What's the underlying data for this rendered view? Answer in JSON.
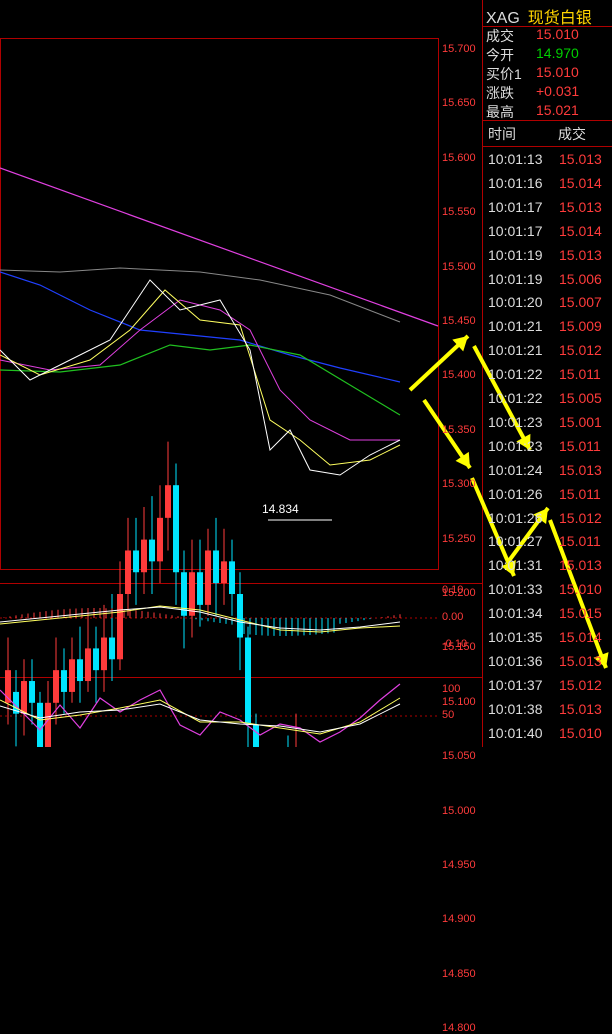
{
  "header": {
    "symbol": "XAG",
    "name": "现货白银"
  },
  "quote": [
    {
      "label": "成交",
      "value": "15.010",
      "color": "#ff3b3b"
    },
    {
      "label": "今开",
      "value": "14.970",
      "color": "#00d000"
    },
    {
      "label": "买价1",
      "value": "15.010",
      "color": "#ff3b3b"
    },
    {
      "label": "涨跌",
      "value": "+0.031",
      "color": "#ff3b3b"
    },
    {
      "label": "最高",
      "value": "15.021",
      "color": "#ff3b3b"
    }
  ],
  "tick_header": {
    "time": "时间",
    "price": "成交"
  },
  "ticks": [
    {
      "time": "10:01:13",
      "price": "15.013"
    },
    {
      "time": "10:01:16",
      "price": "15.014"
    },
    {
      "time": "10:01:17",
      "price": "15.013"
    },
    {
      "time": "10:01:17",
      "price": "15.014"
    },
    {
      "time": "10:01:19",
      "price": "15.013"
    },
    {
      "time": "10:01:19",
      "price": "15.006"
    },
    {
      "time": "10:01:20",
      "price": "15.007"
    },
    {
      "time": "10:01:21",
      "price": "15.009"
    },
    {
      "time": "10:01:21",
      "price": "15.012"
    },
    {
      "time": "10:01:22",
      "price": "15.011"
    },
    {
      "time": "10:01:22",
      "price": "15.005"
    },
    {
      "time": "10:01:23",
      "price": "15.001"
    },
    {
      "time": "10:01:23",
      "price": "15.011"
    },
    {
      "time": "10:01:24",
      "price": "15.013"
    },
    {
      "time": "10:01:26",
      "price": "15.011"
    },
    {
      "time": "10:01:26",
      "price": "15.012"
    },
    {
      "time": "10:01:27",
      "price": "15.011"
    },
    {
      "time": "10:01:31",
      "price": "15.013"
    },
    {
      "time": "10:01:33",
      "price": "15.010"
    },
    {
      "time": "10:01:34",
      "price": "15.015"
    },
    {
      "time": "10:01:35",
      "price": "15.014"
    },
    {
      "time": "10:01:36",
      "price": "15.013"
    },
    {
      "time": "10:01:37",
      "price": "15.012"
    },
    {
      "time": "10:01:38",
      "price": "15.013"
    },
    {
      "time": "10:01:40",
      "price": "15.010"
    }
  ],
  "price_axis": [
    "15.700",
    "15.650",
    "15.600",
    "15.550",
    "15.500",
    "15.450",
    "15.400",
    "15.350",
    "15.300",
    "15.250",
    "15.200",
    "15.150",
    "15.100",
    "15.050",
    "15.000",
    "14.950",
    "14.900",
    "14.850",
    "14.800"
  ],
  "low_marker": "14.834",
  "macd_axis": [
    "0.10",
    "0.00",
    "-0.10"
  ],
  "osc_axis": [
    "100",
    "50"
  ],
  "colors": {
    "up": "#00e5ff",
    "down": "#ff3b3b",
    "grid": "#b00000",
    "arrow": "#ffff00"
  }
}
